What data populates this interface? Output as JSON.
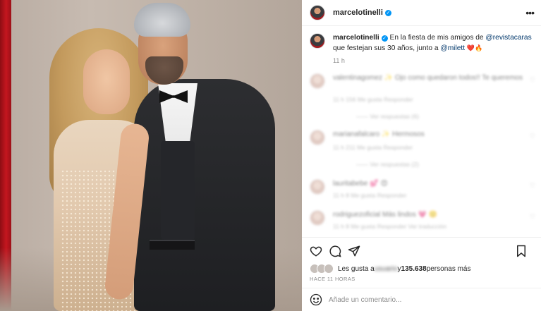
{
  "post": {
    "username": "marcelotinelli",
    "more_label": "•••"
  },
  "caption": {
    "username": "marcelotinelli",
    "text_before": " En la fiesta de mis amigos de ",
    "mention_1": "@revistacaras",
    "text_middle": " que festejan sus 30 años, junto a ",
    "mention_2": "@milett",
    "emojis": "❤️🔥",
    "time": "11 h"
  },
  "comments": [
    {
      "text": "valentinagomez ✨ Ojo como quedaron todos!! Te queremos",
      "meta": "11 h  156 Me gusta  Responder",
      "replies": "—— Ver respuestas (6)"
    },
    {
      "text": "marianafalcaro ✨ Hermosos",
      "meta": "11 h  211 Me gusta  Responder",
      "replies": "—— Ver respuestas (2)"
    },
    {
      "text": "lauritabebe 💕 😍",
      "meta": "11 h  8 Me gusta  Responder",
      "replies": ""
    },
    {
      "text": "rodriguezoficial Más lindos 💗 🙂",
      "meta": "11 h  8 Me gusta  Responder  Ver traducción",
      "replies": ""
    }
  ],
  "likes": {
    "prefix": "Les gusta a ",
    "blurred_name": "usuario",
    "middle": " y ",
    "count": "135.638",
    "suffix": " personas más"
  },
  "time_ago": "HACE 11 HORAS",
  "comment_box": {
    "placeholder": "Añade un comentario..."
  },
  "icons": {
    "like": "heart-icon",
    "comment": "comment-icon",
    "share": "share-icon",
    "save": "bookmark-icon",
    "emoji": "emoji-icon"
  },
  "colors": {
    "link": "#00376b",
    "verified": "#0095f6",
    "muted": "#8e8e8e",
    "curtain": "#c4161f"
  }
}
